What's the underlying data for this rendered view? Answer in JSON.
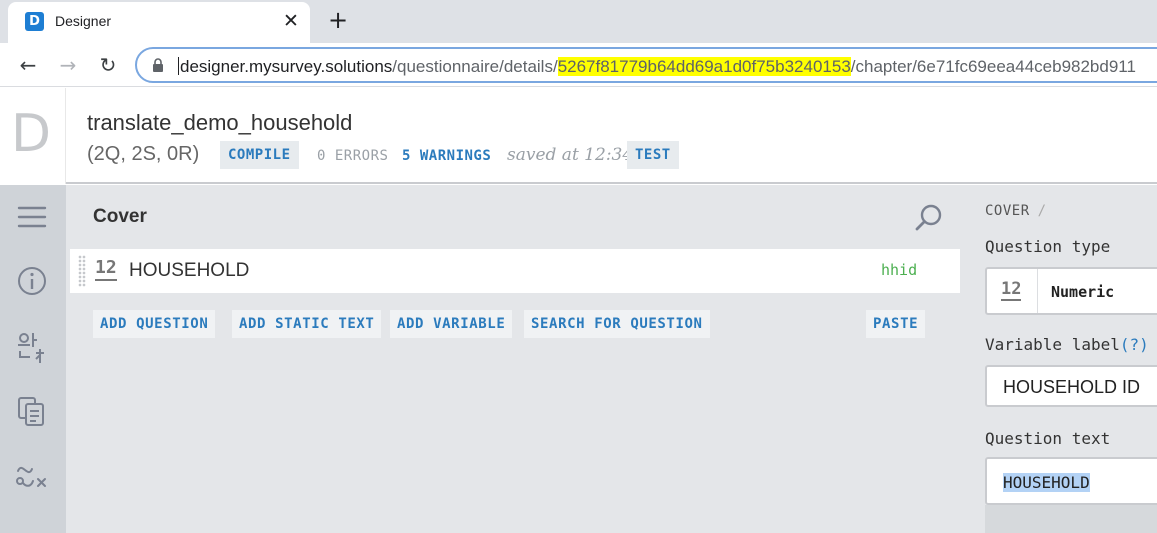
{
  "browser": {
    "tab": {
      "favicon_letter": "D",
      "title": "Designer",
      "close": "✕"
    },
    "new_tab": "+",
    "nav": {
      "back": "←",
      "forward": "→",
      "reload": "↻"
    },
    "url": {
      "host": "designer.mysurvey.solutions",
      "path_before": "/questionnaire/details/",
      "highlighted_id": "5267f81779b64dd69a1d0f75b3240153",
      "path_after": "/chapter/6e71fc69eea44ceb982bd911"
    }
  },
  "app": {
    "logo": "D",
    "questionnaire_title": "translate_demo_household",
    "stats": "(2Q, 2S, 0R)",
    "compile_label": "COMPILE",
    "errors_label": "0 ERRORS",
    "warnings_label": "5 WARNINGS",
    "saved_label": "saved at 12:34",
    "test_label": "TEST"
  },
  "rail": {
    "icons": [
      "menu-icon",
      "info-icon",
      "translate-icon",
      "copy-icon",
      "variables-icon"
    ]
  },
  "chapter": {
    "title": "Cover",
    "questions": [
      {
        "type_icon": "12",
        "text": "HOUSEHOLD",
        "variable": "hhid"
      }
    ],
    "actions": {
      "add_question": "ADD QUESTION",
      "add_static_text": "ADD STATIC TEXT",
      "add_variable": "ADD VARIABLE",
      "search_for_question": "SEARCH FOR QUESTION",
      "paste": "PASTE"
    }
  },
  "panel": {
    "breadcrumb": "COVER",
    "breadcrumb_sep": "/",
    "question_type_label": "Question type",
    "question_type_icon": "12",
    "question_type_value": "Numeric",
    "variable_label_label": "Variable label",
    "variable_label_help": "(?)",
    "variable_label_value": "HOUSEHOLD ID",
    "question_text_label": "Question text",
    "question_text_value": "HOUSEHOLD"
  },
  "colors": {
    "accent": "#2b7bbd",
    "variable_green": "#4caf50",
    "url_highlight": "#ffff00"
  }
}
